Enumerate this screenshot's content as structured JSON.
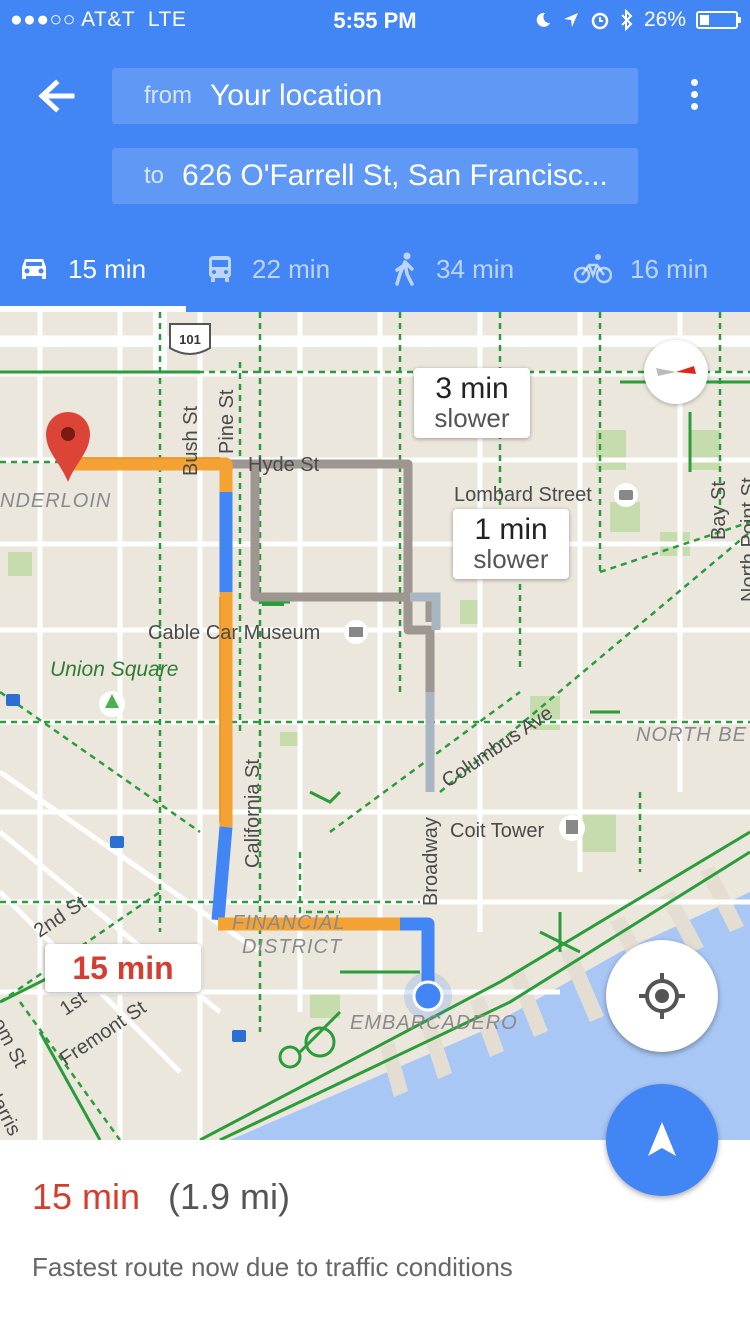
{
  "status_bar": {
    "carrier": "●●●○○ AT&T",
    "network": "LTE",
    "time": "5:55 PM",
    "battery": "26%"
  },
  "directions": {
    "from_label": "from",
    "from_value": "Your location",
    "to_label": "to",
    "to_value": "626 O'Farrell St, San Francisc..."
  },
  "modes": [
    {
      "icon": "car-icon",
      "time": "15 min",
      "active": true
    },
    {
      "icon": "transit-icon",
      "time": "22 min",
      "active": false
    },
    {
      "icon": "walk-icon",
      "time": "34 min",
      "active": false
    },
    {
      "icon": "bike-icon",
      "time": "16 min",
      "active": false
    }
  ],
  "map": {
    "labels": {
      "hyde": "Hyde St",
      "bush": "Bush St",
      "pine": "Pine St",
      "tenderloin": "NDERLOIN",
      "lombard": "Lombard Street",
      "bay": "Bay St",
      "north_point": "North Point St",
      "cable_car": "Cable Car Museum",
      "union_square": "Union Square",
      "columbus": "Columbus Ave",
      "north_beach": "NORTH BE",
      "california": "California St",
      "coit": "Coit Tower",
      "broadway": "Broadway",
      "second": "2nd St",
      "first": "1st",
      "fremont": "Fremont St",
      "folsom": "lsom St",
      "harrison": "Harris",
      "financial1": "FINANCIAL",
      "financial2": "DISTRICT",
      "embarcadero": "EMBARCADERO",
      "hwy": "101"
    },
    "callouts": {
      "alt1_time": "3 min",
      "alt1_note": "slower",
      "alt2_time": "1 min",
      "alt2_note": "slower",
      "main_time": "15 min"
    }
  },
  "summary": {
    "time": "15 min",
    "distance": "(1.9 mi)",
    "note": "Fastest route now due to traffic conditions"
  },
  "colors": {
    "header_blue": "#4285f4",
    "route_orange": "#f4a233",
    "route_blue": "#4285f4",
    "alt_route": "#a59e97",
    "time_red": "#d23f31"
  }
}
